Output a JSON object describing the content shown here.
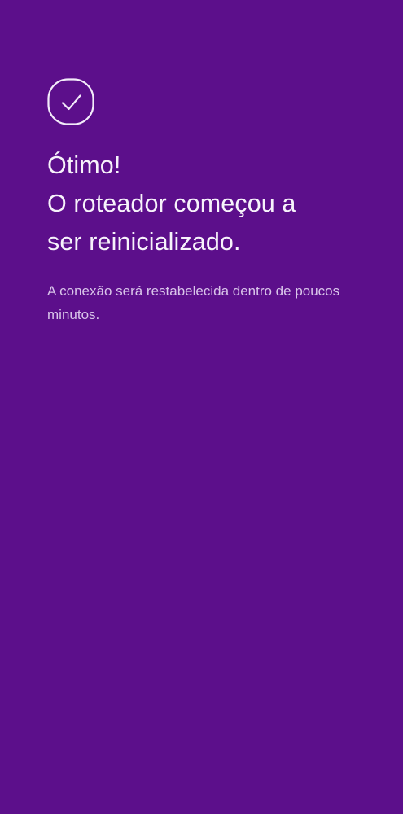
{
  "screen": {
    "background_color": "#5c0f8b",
    "icon": "check-circle-icon",
    "title_lines": [
      "Ótimo!",
      "O roteador começou a",
      "ser reinicializado."
    ],
    "message": "A conexão será restabelecida dentro de poucos minutos."
  }
}
